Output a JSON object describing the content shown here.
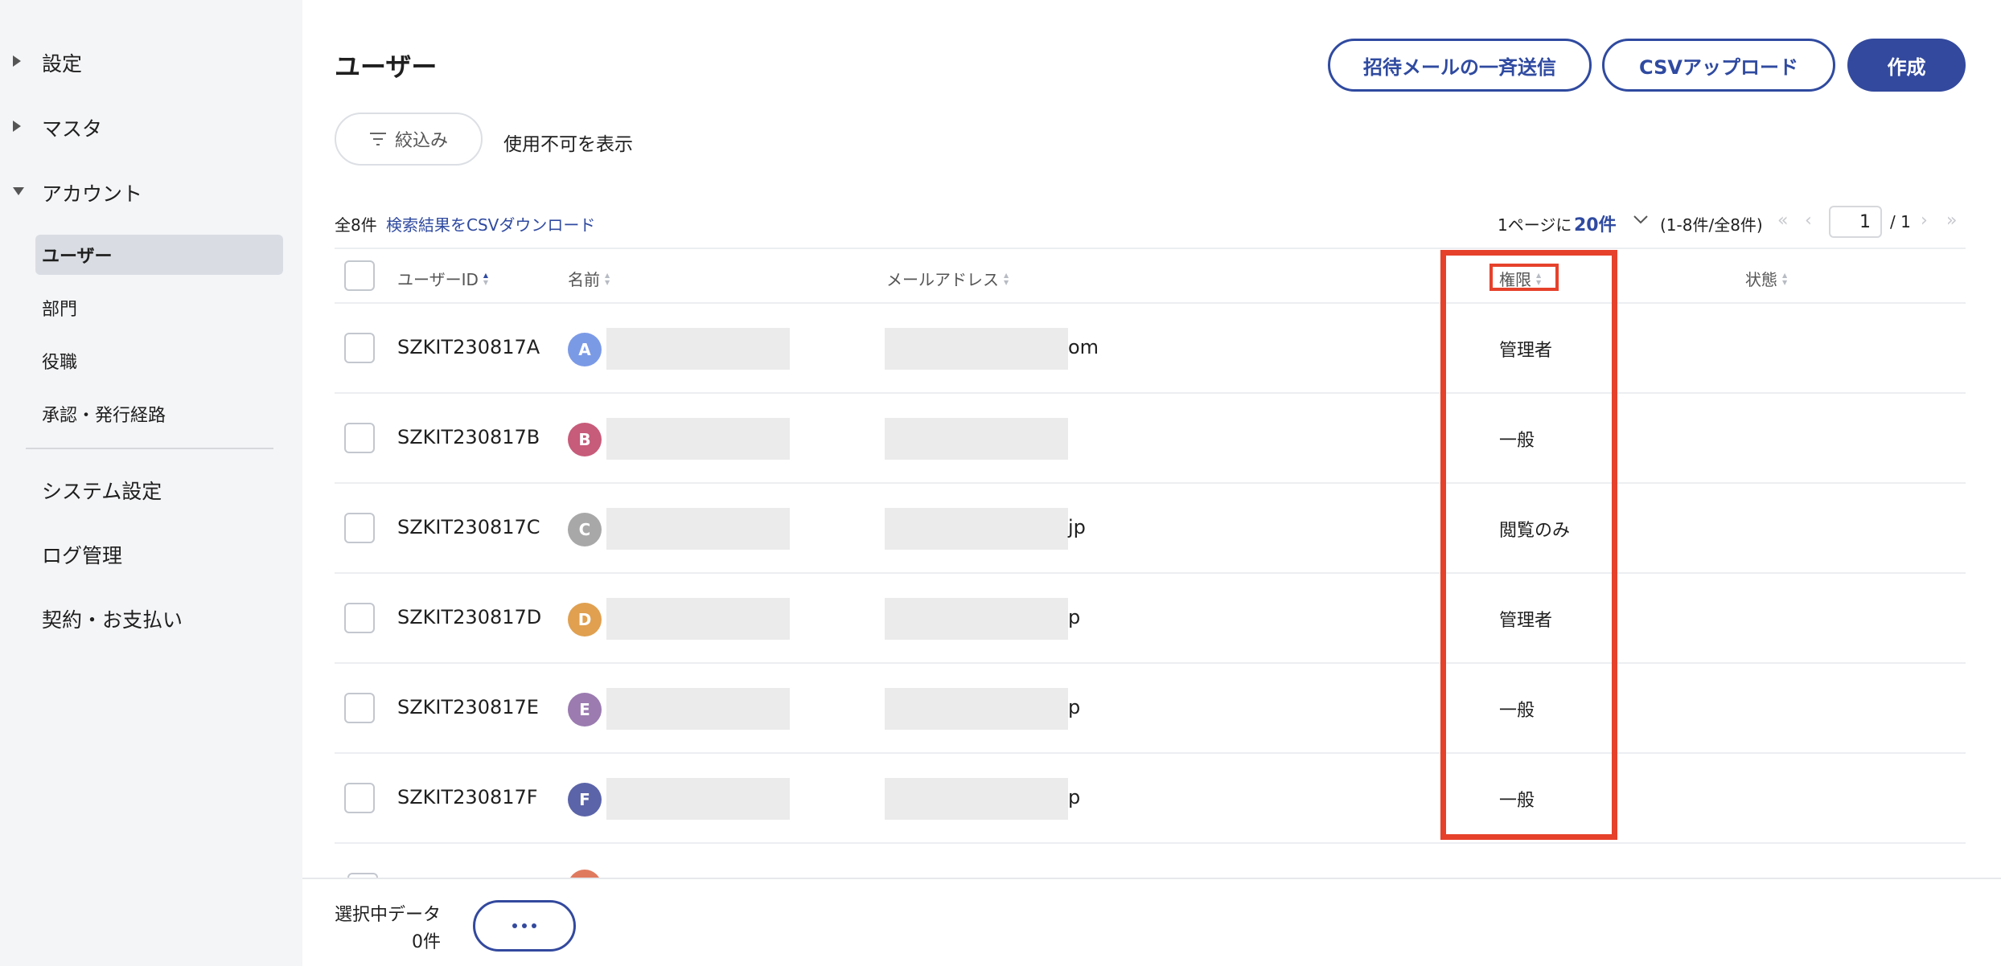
{
  "sidebar": {
    "groups": [
      {
        "label": "設定",
        "expanded": false
      },
      {
        "label": "マスタ",
        "expanded": false
      },
      {
        "label": "アカウント",
        "expanded": true
      }
    ],
    "account_items": [
      {
        "label": "ユーザー",
        "active": true
      },
      {
        "label": "部門",
        "active": false
      },
      {
        "label": "役職",
        "active": false
      },
      {
        "label": "承認・発行経路",
        "active": false
      }
    ],
    "top_items": [
      {
        "label": "システム設定"
      },
      {
        "label": "ログ管理"
      },
      {
        "label": "契約・お支払い"
      }
    ]
  },
  "header": {
    "title": "ユーザー",
    "bulk_invite_label": "招待メールの一斉送信",
    "csv_upload_label": "CSVアップロード",
    "create_label": "作成"
  },
  "filters": {
    "filter_label": "絞込み",
    "show_disabled_label": "使用不可を表示"
  },
  "list_meta": {
    "total_label": "全8件",
    "csv_download_label": "検索結果をCSVダウンロード",
    "per_page_prefix": "1ページに",
    "per_page_value": "20件",
    "range_label": "(1-8件/全8件)",
    "current_page": "1",
    "total_pages_label": "/ 1"
  },
  "table": {
    "columns": {
      "user_id": "ユーザーID",
      "name": "名前",
      "email": "メールアドレス",
      "role": "権限",
      "status": "状態"
    },
    "rows": [
      {
        "user_id": "SZKIT230817A",
        "avatar": "A",
        "avatar_color": "#7b9ae6",
        "email_tail": "om",
        "role": "管理者"
      },
      {
        "user_id": "SZKIT230817B",
        "avatar": "B",
        "avatar_color": "#c75b7a",
        "email_tail": "",
        "role": "一般"
      },
      {
        "user_id": "SZKIT230817C",
        "avatar": "C",
        "avatar_color": "#a8a8a8",
        "email_tail": "jp",
        "role": "閲覧のみ"
      },
      {
        "user_id": "SZKIT230817D",
        "avatar": "D",
        "avatar_color": "#e0a050",
        "email_tail": "p",
        "role": "管理者"
      },
      {
        "user_id": "SZKIT230817E",
        "avatar": "E",
        "avatar_color": "#9b7bb0",
        "email_tail": "p",
        "role": "一般"
      },
      {
        "user_id": "SZKIT230817F",
        "avatar": "F",
        "avatar_color": "#5b64a8",
        "email_tail": "p",
        "role": "一般"
      }
    ]
  },
  "footer": {
    "selected_label": "選択中データ",
    "selected_count": "0件"
  },
  "colors": {
    "accent": "#33499e",
    "highlight": "#e6412b"
  }
}
